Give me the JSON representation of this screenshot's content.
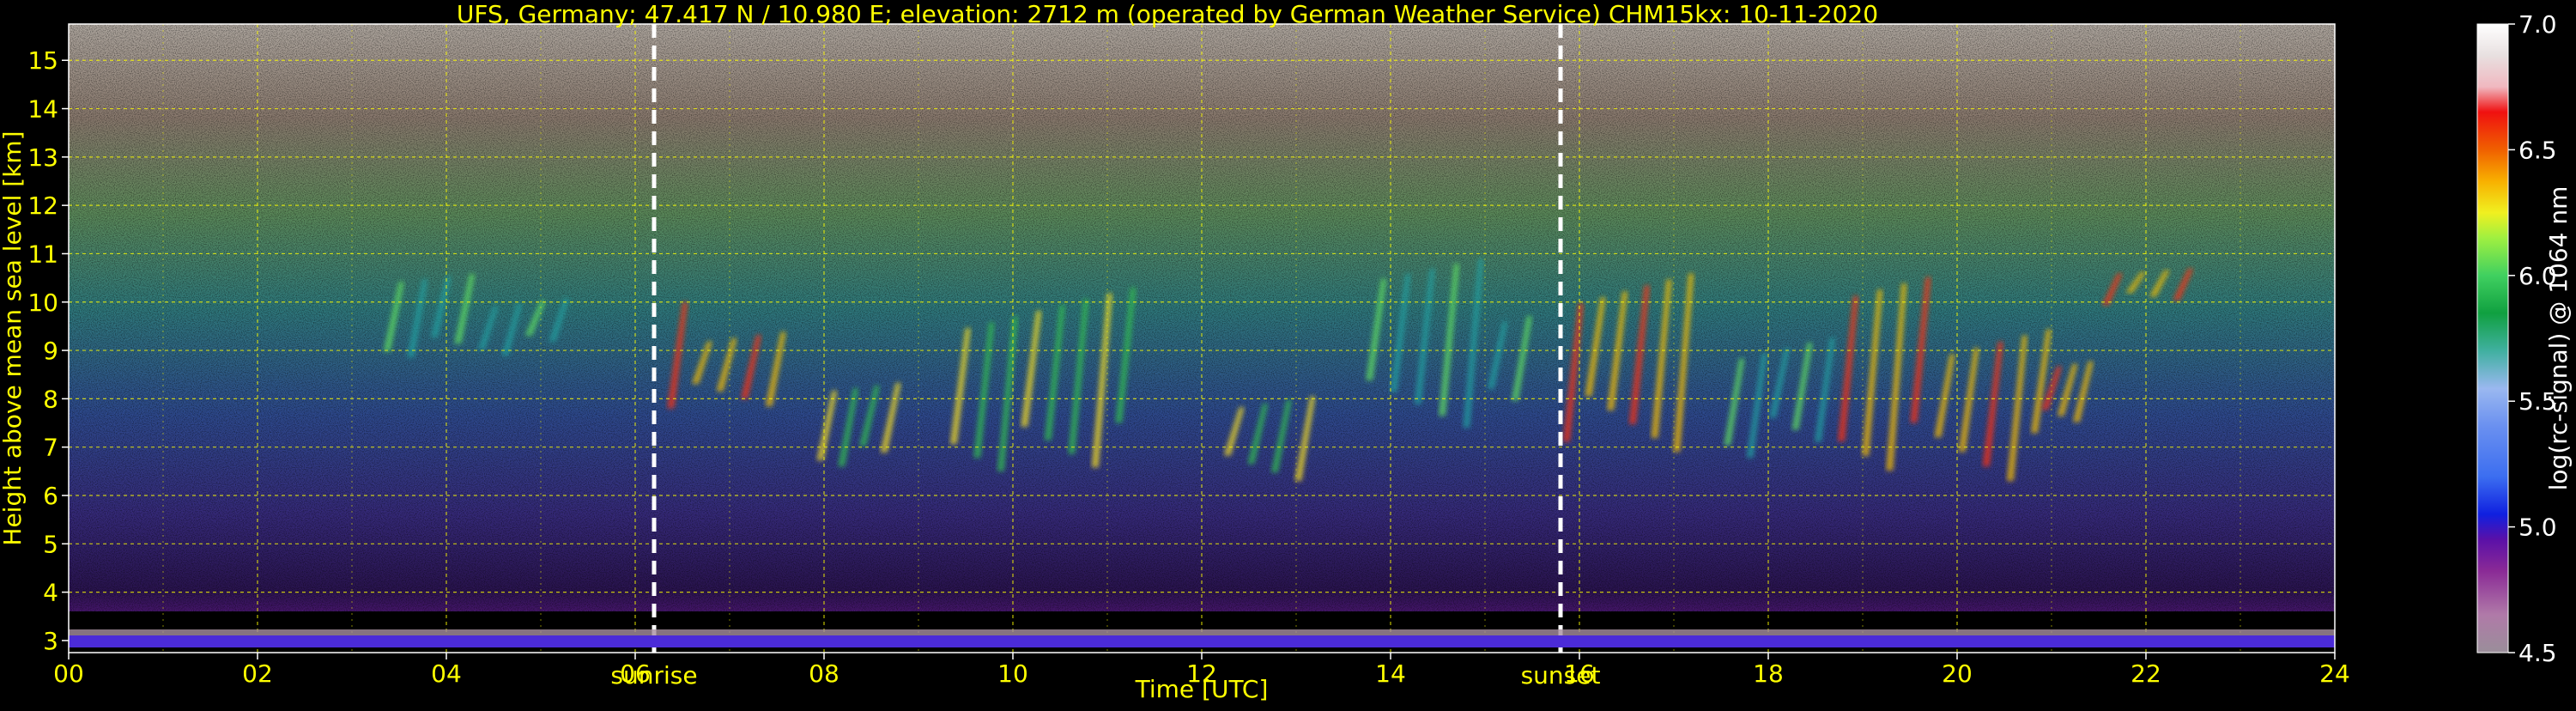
{
  "chart_data": {
    "type": "heatmap",
    "title": "UFS, Germany; 47.417 N / 10.980 E; elevation: 2712 m  (operated by German Weather Service)    CHM15kx: 10-11-2020",
    "xlabel": "Time [UTC]",
    "ylabel": "Height above mean sea level [km]",
    "xlim": [
      0,
      24
    ],
    "ylim": [
      2.75,
      15.75
    ],
    "x_ticks": [
      "00",
      "02",
      "04",
      "06",
      "08",
      "10",
      "12",
      "14",
      "16",
      "18",
      "20",
      "22",
      "24"
    ],
    "y_ticks": [
      "3",
      "4",
      "5",
      "6",
      "7",
      "8",
      "9",
      "10",
      "11",
      "12",
      "13",
      "14",
      "15"
    ],
    "grid": true,
    "colorbar": {
      "label": "log(rc-signal) @ 1064 nm",
      "range": [
        4.5,
        7.0
      ],
      "ticks": [
        "4.5",
        "5.0",
        "5.5",
        "6.0",
        "6.5",
        "7.0"
      ]
    },
    "markers": [
      {
        "label": "sunrise",
        "x": 6.2
      },
      {
        "label": "sunset",
        "x": 15.8
      }
    ],
    "cloud_features": [
      {
        "x": [
          6.3,
          7.6
        ],
        "y": [
          7.8,
          10.0
        ],
        "level": 6.3
      },
      {
        "x": [
          7.9,
          8.8
        ],
        "y": [
          6.6,
          8.4
        ],
        "level": 6.1
      },
      {
        "x": [
          9.3,
          11.3
        ],
        "y": [
          6.5,
          10.5
        ],
        "level": 6.2
      },
      {
        "x": [
          12.2,
          13.2
        ],
        "y": [
          6.3,
          8.8
        ],
        "level": 6.1
      },
      {
        "x": [
          13.7,
          15.5
        ],
        "y": [
          7.4,
          10.9
        ],
        "level": 6.0
      },
      {
        "x": [
          15.8,
          17.2
        ],
        "y": [
          6.9,
          11.0
        ],
        "level": 6.3
      },
      {
        "x": [
          17.5,
          18.7
        ],
        "y": [
          6.6,
          10.2
        ],
        "level": 6.0
      },
      {
        "x": [
          18.7,
          21.0
        ],
        "y": [
          6.3,
          10.6
        ],
        "level": 6.6
      },
      {
        "x": [
          20.9,
          21.4
        ],
        "y": [
          7.3,
          9.1
        ],
        "level": 6.4
      },
      {
        "x": [
          21.5,
          22.5
        ],
        "y": [
          9.9,
          11.0
        ],
        "level": 6.4
      },
      {
        "x": [
          3.3,
          5.3
        ],
        "y": [
          8.8,
          10.6
        ],
        "level": 5.6
      }
    ]
  }
}
